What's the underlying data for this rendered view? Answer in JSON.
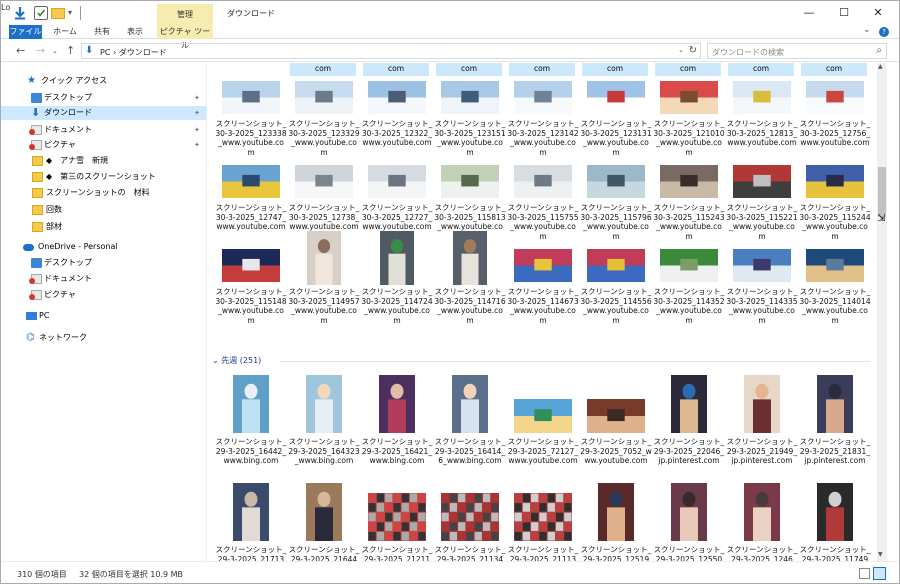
{
  "window": {
    "title": "ダウンロード",
    "left_cut": "Lo",
    "context_tab_header": "管理",
    "controls": {
      "minimize": "—",
      "maximize": "☐",
      "close": "✕"
    }
  },
  "ribbon": {
    "file": "ファイル",
    "home": "ホーム",
    "share": "共有",
    "view": "表示",
    "picture_tools": "ピクチャ ツール",
    "expand": "⌄",
    "help": "?"
  },
  "nav": {
    "back": "←",
    "forward": "→",
    "down": "⌄",
    "up": "↑",
    "address": "PC  ›  ダウンロード",
    "address_drop": "⌄",
    "refresh": "↻",
    "search_placeholder": "ダウンロードの検索",
    "search_icon": "⌕"
  },
  "sidebar": {
    "items": [
      {
        "label": "クイック アクセス",
        "icon": "star-icon",
        "pin": ""
      },
      {
        "label": "デスクトップ",
        "icon": "desktop-icon",
        "pin": "📌"
      },
      {
        "label": "ダウンロード",
        "icon": "download-icon",
        "pin": "📌"
      },
      {
        "label": "ドキュメント",
        "icon": "documents-icon",
        "pin": "📌"
      },
      {
        "label": "ピクチャ",
        "icon": "pictures-icon",
        "pin": "📌"
      },
      {
        "label": "◆　アナ雪　新規",
        "icon": "folder-icon",
        "pin": ""
      },
      {
        "label": "◆　第三のスクリーンショット",
        "icon": "folder-icon",
        "pin": ""
      },
      {
        "label": "スクリーンショットの　材料",
        "icon": "folder-icon",
        "pin": ""
      },
      {
        "label": "回数",
        "icon": "folder-icon",
        "pin": ""
      },
      {
        "label": "部材",
        "icon": "folder-icon",
        "pin": ""
      },
      {
        "label": "OneDrive - Personal",
        "icon": "onedrive-icon",
        "pin": ""
      },
      {
        "label": "デスクトップ",
        "icon": "desktop-icon",
        "pin": ""
      },
      {
        "label": "ドキュメント",
        "icon": "documents-icon",
        "pin": ""
      },
      {
        "label": "ピクチャ",
        "icon": "pictures-icon",
        "pin": ""
      },
      {
        "label": "PC",
        "icon": "pc-icon",
        "pin": ""
      },
      {
        "label": "ネットワーク",
        "icon": "network-icon",
        "pin": ""
      }
    ]
  },
  "content": {
    "top_strip": [
      "com",
      "com",
      "com",
      "com",
      "com",
      "com",
      "com",
      "com"
    ],
    "rows": [
      [
        "スクリーンショット_30-3-2025_123338_www.youtube.com",
        "スクリーンショット_30-3-2025_123329_www.youtube.com",
        "スクリーンショット_30-3-2025_12322_www.youtube.com",
        "スクリーンショット_30-3-2025_123151_www.youtube.com",
        "スクリーンショット_30-3-2025_123142_www.youtube.com",
        "スクリーンショット_30-3-2025_123131_www.youtube.com",
        "スクリーンショット_30-3-2025_121010_www.youtube.com",
        "スクリーンショット_30-3-2025_12813_www.youtube.com",
        "スクリーンショット_30-3-2025_12756_www.youtube.com"
      ],
      [
        "スクリーンショット_30-3-2025_12747_www.youtube.com",
        "スクリーンショット_30-3-2025_12738_www.youtube.com",
        "スクリーンショット_30-3-2025_12727_www.youtube.com",
        "スクリーンショット_30-3-2025_115813_www.youtube.com",
        "スクリーンショット_30-3-2025_115755_www.youtube.com",
        "スクリーンショット_30-3-2025_115796_www.youtube.com",
        "スクリーンショット_30-3-2025_115243_www.youtube.com",
        "スクリーンショット_30-3-2025_115221_www.youtube.com",
        "スクリーンショット_30-3-2025_115244_www.youtube.com"
      ],
      [
        "スクリーンショット_30-3-2025_115148_www.youtube.com",
        "スクリーンショット_30-3-2025_114957_www.youtube.com",
        "スクリーンショット_30-3-2025_114724_www.youtube.com",
        "スクリーンショット_30-3-2025_114716_www.youtube.com",
        "スクリーンショット_30-3-2025_114673_www.youtube.com",
        "スクリーンショット_30-3-2025_114556_www.youtube.com",
        "スクリーンショット_30-3-2025_114352_www.youtube.com",
        "スクリーンショット_30-3-2025_114335_www.youtube.com",
        "スクリーンショット_30-3-2025_114014_www.youtube.com"
      ]
    ],
    "group_header": "先週 (251)",
    "group_rows": [
      [
        "スクリーンショット_29-3-2025_16442_www.bing.com",
        "スクリーンショット_29-3-2025_164323_www.bing.com",
        "スクリーンショット_29-3-2025_16421_www.bing.com",
        "スクリーンショット_29-3-2025_16414_6_www.bing.com",
        "スクリーンショット_29-3-2025_72127_www.youtube.com",
        "スクリーンショット_29-3-2025_7052_www.youtube.com",
        "スクリーンショット_29-3-2025_22046_jp.pinterest.com",
        "スクリーンショット_29-3-2025_21949_jp.pinterest.com",
        "スクリーンショット_29-3-2025_21831_jp.pinterest.com"
      ],
      [
        "スクリーンショット_29-3-2025_21713",
        "スクリーンショット_29-3-2025_21644",
        "スクリーンショット_29-3-2025_21211",
        "スクリーンショット_29-3-2025_21134",
        "スクリーンショット_29-3-2025_21113",
        "スクリーンショット_29-3-2025_12519",
        "スクリーンショット_29-3-2025_12550",
        "スクリーンショット_29-3-2025_1246",
        "スクリーンショット_29-3-2025_11749"
      ]
    ]
  },
  "status": {
    "count": "310 個の項目",
    "selected": "32 個の項目を選択  10.9 MB"
  },
  "colors": {
    "accent": "#1e6fc7",
    "selection": "#cce8fb",
    "context_tab": "#f7ecb0"
  }
}
